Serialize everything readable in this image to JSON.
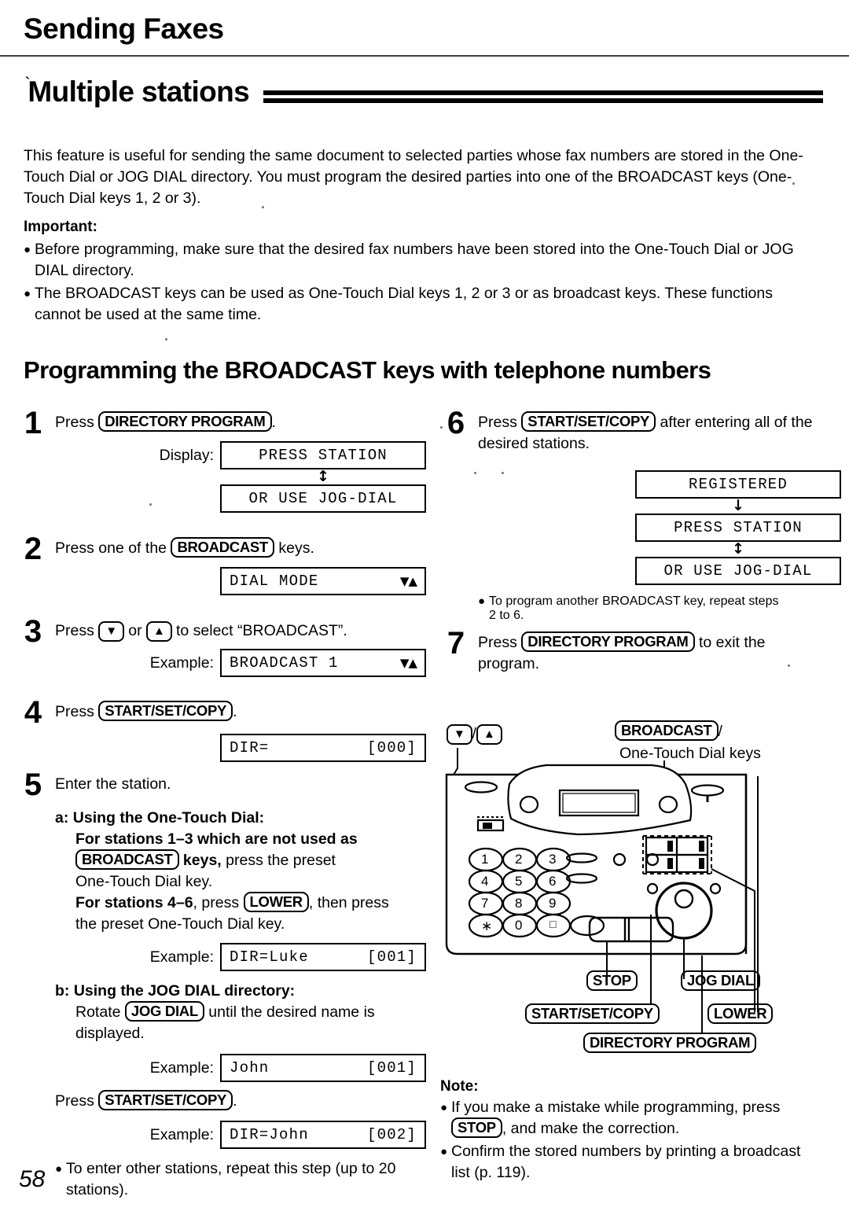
{
  "header": {
    "chapter_title": "Sending Faxes",
    "section_title": "Multiple stations"
  },
  "intro": {
    "paragraph": "This feature is useful for sending the same document to selected parties whose fax numbers are stored in the One-Touch Dial or JOG DIAL directory. You must program the desired parties into one of the BROADCAST keys (One-Touch Dial keys 1, 2 or 3).",
    "important_label": "Important:",
    "important_bullets": [
      "Before programming, make sure that the desired fax numbers have been stored into the One-Touch Dial or JOG DIAL directory.",
      "The BROADCAST keys can be used as One-Touch Dial keys 1, 2 or 3 or as broadcast keys. These functions cannot be used at the same time."
    ]
  },
  "procedure": {
    "heading": "Programming the BROADCAST keys with telephone numbers"
  },
  "steps": {
    "s1": {
      "num": "1",
      "press_word": "Press",
      "key": "DIRECTORY PROGRAM",
      "period": ".",
      "display_label": "Display:",
      "lcd1": "PRESS STATION",
      "lcd2": "OR USE JOG-DIAL",
      "arrow": "↕"
    },
    "s2": {
      "num": "2",
      "text_before": "Press one of the",
      "key": "BROADCAST",
      "text_after": "keys.",
      "lcd_left": "DIAL MODE",
      "lcd_right": "▼▲"
    },
    "s3": {
      "num": "3",
      "text_before": "Press",
      "key_down": "▼",
      "text_mid": "or",
      "key_up": "▲",
      "text_after": "to select “BROADCAST”.",
      "example_label": "Example:",
      "lcd_left": "BROADCAST 1",
      "lcd_right": "▼▲"
    },
    "s4": {
      "num": "4",
      "press_word": "Press",
      "key": "START/SET/COPY",
      "period": ".",
      "lcd_left": "DIR=",
      "lcd_right": "[000]"
    },
    "s5": {
      "num": "5",
      "title": "Enter the station.",
      "a_label": "a:",
      "a_title": "Using the One-Touch Dial:",
      "a_line1_bold": "For stations 1–3 which are not used as",
      "a_key": "BROADCAST",
      "a_line2_bold": "keys,",
      "a_line2_rest": "press the preset",
      "a_line3": "One-Touch Dial key.",
      "a_line4_bold": "For stations 4–6",
      "a_line4_mid": ", press",
      "a_key2": "LOWER",
      "a_line4_rest": ", then press",
      "a_line5": "the preset One-Touch Dial key.",
      "a_example_label": "Example:",
      "a_lcd_left": "DIR=Luke",
      "a_lcd_right": "[001]",
      "b_label": "b:",
      "b_title": "Using the JOG DIAL directory:",
      "b_rotate": "Rotate",
      "b_key": "JOG DIAL",
      "b_line1_rest": "until the desired name is",
      "b_line2": "displayed.",
      "b_example_label": "Example:",
      "b_lcd_left": "John",
      "b_lcd_right": "[001]",
      "b_press": "Press",
      "b_key2": "START/SET/COPY",
      "b_press_period": ".",
      "b_example2_label": "Example:",
      "b_lcd2_left": "DIR=John",
      "b_lcd2_right": "[002]",
      "bullet": "To enter other stations, repeat this step (up to 20 stations)."
    },
    "s6": {
      "num": "6",
      "text_before": "Press",
      "key": "START/SET/COPY",
      "text_after": "after entering all of the desired stations.",
      "lcd1": "REGISTERED",
      "lcd2": "PRESS STATION",
      "lcd3": "OR USE JOG-DIAL",
      "arrow_down": "↓",
      "arrow_both": "↕",
      "bullet": "To program another BROADCAST key, repeat steps 2 to 6."
    },
    "s7": {
      "num": "7",
      "text_before": "Press",
      "key": "DIRECTORY PROGRAM",
      "text_after": "to exit the program."
    }
  },
  "diagram": {
    "arrow_down_key": "▼",
    "slash": "/",
    "arrow_up_key": "▲",
    "broadcast_key": "BROADCAST",
    "broadcast_suffix": "/",
    "one_touch_label": "One-Touch Dial keys",
    "keypad": [
      "1",
      "2",
      "3",
      "4",
      "5",
      "6",
      "7",
      "8",
      "9",
      "∗",
      "0",
      "□"
    ],
    "callouts": {
      "stop": "STOP",
      "jog_dial": "JOG DIAL",
      "start_set_copy": "START/SET/COPY",
      "lower": "LOWER",
      "directory_program": "DIRECTORY PROGRAM"
    }
  },
  "note": {
    "label": "Note:",
    "bullets": [
      {
        "pre": "If you make a mistake while programming, press",
        "key": "STOP",
        "post": ", and make the correction."
      },
      {
        "pre": "Confirm the stored numbers by printing a broadcast list (p. 119).",
        "key": "",
        "post": ""
      }
    ]
  },
  "footer": {
    "page_number": "58"
  }
}
